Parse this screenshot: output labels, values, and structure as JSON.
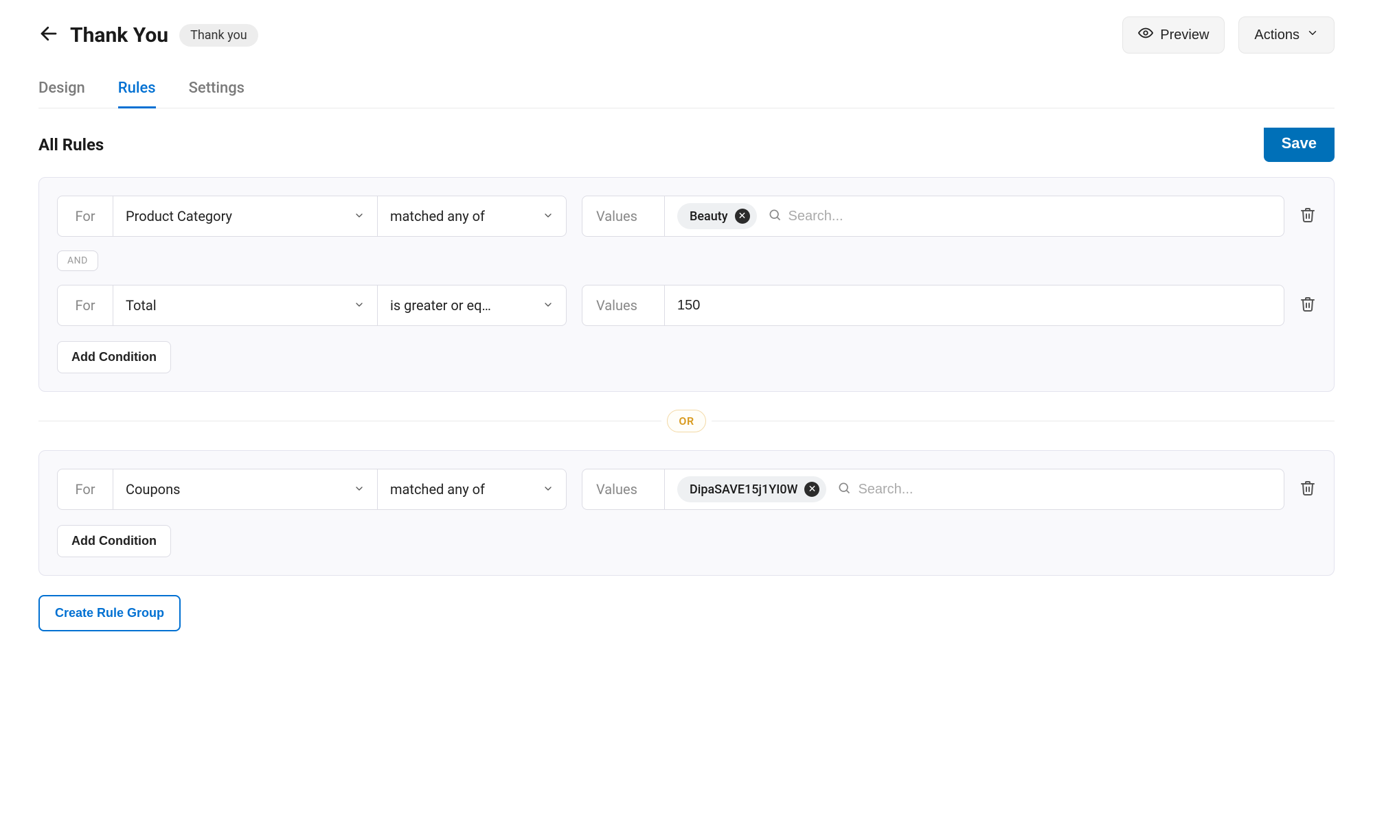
{
  "header": {
    "title": "Thank You",
    "badge": "Thank you",
    "preview": "Preview",
    "actions": "Actions"
  },
  "tabs": {
    "design": "Design",
    "rules": "Rules",
    "settings": "Settings",
    "active": "rules"
  },
  "section": {
    "title": "All Rules",
    "save": "Save"
  },
  "labels": {
    "for": "For",
    "values": "Values",
    "and": "AND",
    "or": "OR",
    "add_condition": "Add Condition",
    "create_rule_group": "Create Rule Group",
    "search_placeholder": "Search..."
  },
  "groups": [
    {
      "conditions": [
        {
          "field": "Product Category",
          "operator": "matched any of",
          "type": "chips",
          "chips": [
            "Beauty"
          ]
        },
        {
          "field": "Total",
          "operator": "is greater or eq…",
          "type": "input",
          "value": "150"
        }
      ]
    },
    {
      "conditions": [
        {
          "field": "Coupons",
          "operator": "matched any of",
          "type": "chips",
          "chips": [
            "DipaSAVE15j1YI0W"
          ]
        }
      ]
    }
  ]
}
